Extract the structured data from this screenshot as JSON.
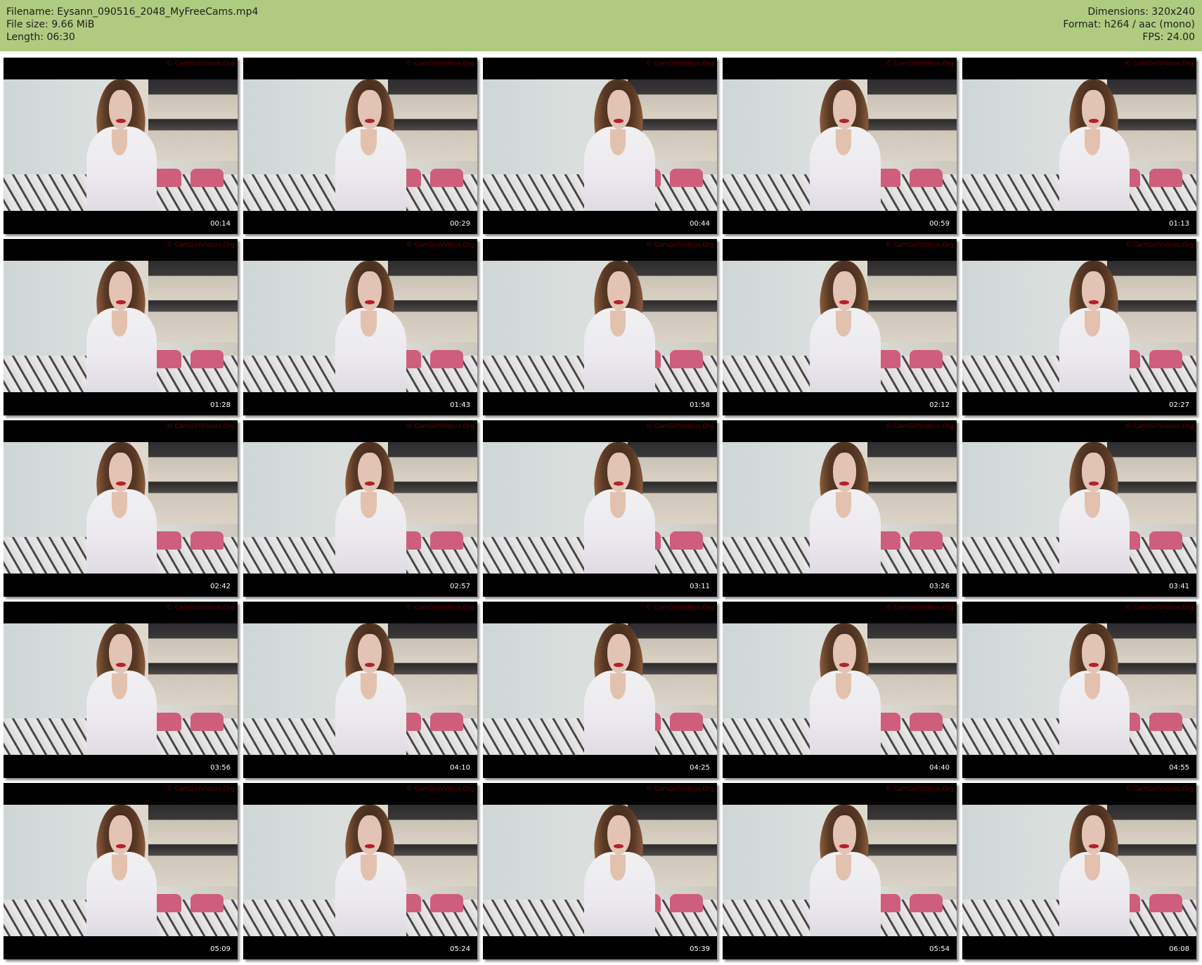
{
  "header": {
    "filename": "Filename: Eysann_090516_2048_MyFreeCams.mp4",
    "filesize": "File size: 9.66 MiB",
    "length": "Length: 06:30",
    "dimensions": "Dimensions: 320x240",
    "format": "Format: h264 / aac (mono)",
    "fps": "FPS: 24.00"
  },
  "thumbnails": [
    {
      "time": "00:14"
    },
    {
      "time": "00:29"
    },
    {
      "time": "00:44"
    },
    {
      "time": "00:59"
    },
    {
      "time": "01:13"
    },
    {
      "time": "01:28"
    },
    {
      "time": "01:43"
    },
    {
      "time": "01:58"
    },
    {
      "time": "02:12"
    },
    {
      "time": "02:27"
    },
    {
      "time": "02:42"
    },
    {
      "time": "02:57"
    },
    {
      "time": "03:11"
    },
    {
      "time": "03:26"
    },
    {
      "time": "03:41"
    },
    {
      "time": "03:56"
    },
    {
      "time": "04:10"
    },
    {
      "time": "04:25"
    },
    {
      "time": "04:40"
    },
    {
      "time": "04:55"
    },
    {
      "time": "05:09"
    },
    {
      "time": "05:24"
    },
    {
      "time": "05:39"
    },
    {
      "time": "05:54"
    },
    {
      "time": "06:08"
    }
  ],
  "watermark": "© CamGirlVideos.Org"
}
